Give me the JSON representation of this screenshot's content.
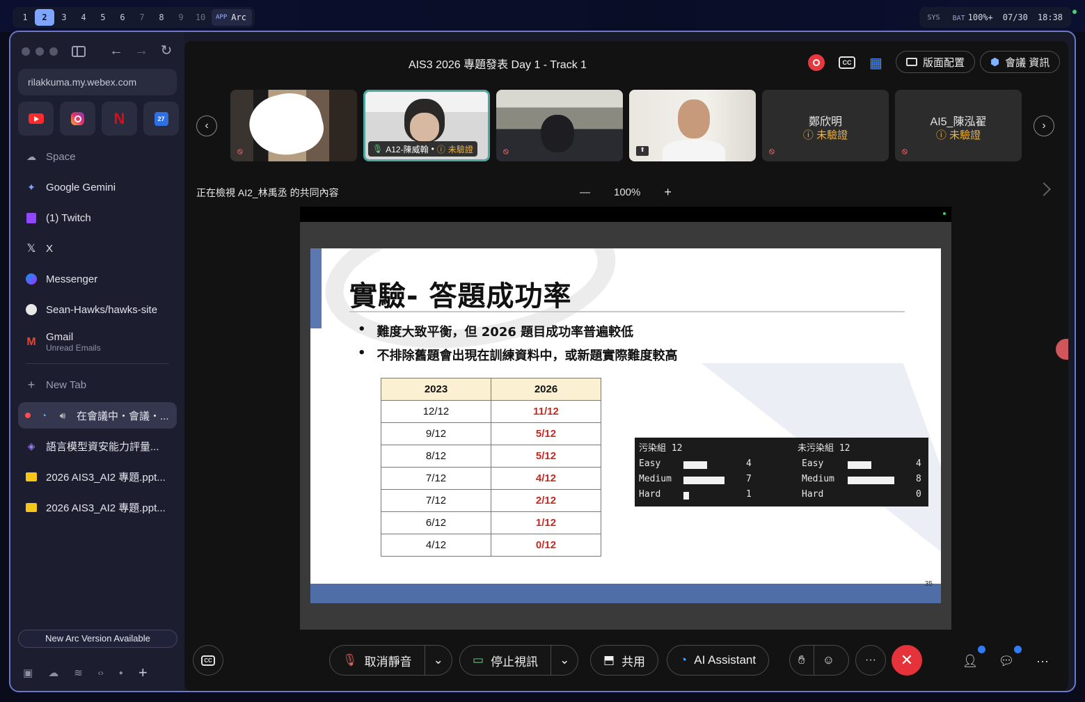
{
  "topbar": {
    "workspaces": [
      "1",
      "2",
      "3",
      "4",
      "5",
      "6",
      "7",
      "8",
      "9",
      "10"
    ],
    "active_workspace": "2",
    "app_tag": "APP",
    "app_name": "Arc",
    "sys_label": "SYS",
    "bat_label": "BAT",
    "battery": "100%+",
    "date": "07/30",
    "time": "18:38"
  },
  "sidebar": {
    "url": "rilakkuma.my.webex.com",
    "favorites": [
      "youtube-icon",
      "instagram-icon",
      "netflix-icon",
      "calendar-icon"
    ],
    "calendar_day": "27",
    "pinned": [
      {
        "label": "Space",
        "icon": "space-icon"
      },
      {
        "label": "Google Gemini",
        "icon": "gemini-icon"
      },
      {
        "label": "(1) Twitch",
        "icon": "twitch-icon"
      },
      {
        "label": "X",
        "icon": "x-icon"
      },
      {
        "label": "Messenger",
        "icon": "messenger-icon"
      },
      {
        "label": "Sean-Hawks/hawks-site",
        "icon": "github-icon"
      }
    ],
    "gmail": {
      "label": "Gmail",
      "sub": "Unread Emails"
    },
    "new_tab": "New Tab",
    "tabs": [
      {
        "label": "在會議中・會議・...",
        "icon": "webex-icon",
        "active": true
      },
      {
        "label": "語言模型資安能力評量...",
        "icon": "layers-icon"
      },
      {
        "label": "2026 AIS3_AI2 專題.ppt...",
        "icon": "slides-icon"
      },
      {
        "label": "2026 AIS3_AI2 專題.ppt...",
        "icon": "slides-icon"
      }
    ],
    "update_banner": "New Arc Version Available"
  },
  "meeting": {
    "title": "AIS3 2026 專題發表 Day 1 - Track 1",
    "layout_label": "版面配置",
    "info_label": "會議 資訊",
    "participants": [
      {
        "name": "",
        "type": "video"
      },
      {
        "name": "A12-陳威翰",
        "status": "未驗證",
        "type": "video",
        "active": true
      },
      {
        "name": "",
        "type": "video"
      },
      {
        "name": "",
        "type": "video"
      },
      {
        "name": "鄭欣明",
        "status": "未驗證",
        "type": "avatar"
      },
      {
        "name": "AI5_陳泓翟",
        "status": "未驗證",
        "type": "avatar"
      }
    ],
    "viewing_text": "正在檢視 AI2_林禹丞 的共同內容",
    "zoom_minus": "—",
    "zoom_level": "100%",
    "zoom_plus": "+"
  },
  "slide": {
    "title": "實驗- 答題成功率",
    "bullets": [
      "難度大致平衡，但 2026 題目成功率普遍較低",
      "不排除舊題會出現在訓練資料中，或新題實際難度較高"
    ],
    "table": {
      "headers": [
        "2023",
        "2026"
      ],
      "rows": [
        [
          "12/12",
          "11/12"
        ],
        [
          "9/12",
          "5/12"
        ],
        [
          "8/12",
          "5/12"
        ],
        [
          "7/12",
          "4/12"
        ],
        [
          "7/12",
          "2/12"
        ],
        [
          "6/12",
          "1/12"
        ],
        [
          "4/12",
          "0/12"
        ]
      ]
    },
    "stats": {
      "left": {
        "title": "污染組 12",
        "rows": [
          {
            "label": "Easy",
            "value": 4
          },
          {
            "label": "Medium",
            "value": 7
          },
          {
            "label": "Hard",
            "value": 1
          }
        ]
      },
      "right": {
        "title": "未污染組 12",
        "rows": [
          {
            "label": "Easy",
            "value": 4
          },
          {
            "label": "Medium",
            "value": 8
          },
          {
            "label": "Hard",
            "value": 0
          }
        ]
      }
    },
    "page_number": "35"
  },
  "controls": {
    "unmute": "取消靜音",
    "stop_video": "停止視訊",
    "share": "共用",
    "ai_assistant": "AI Assistant",
    "more": "···"
  }
}
